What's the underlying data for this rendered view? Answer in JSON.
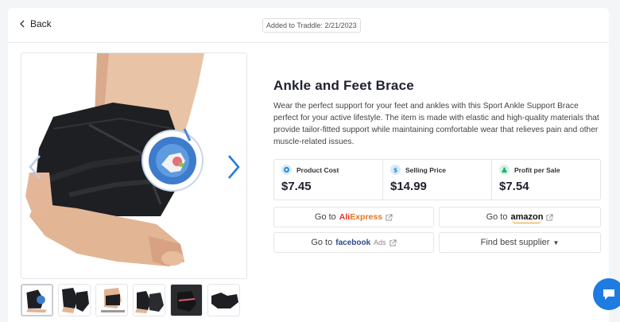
{
  "header": {
    "back_label": "Back",
    "added_label": "Added to Traddle: 2/21/2023"
  },
  "product": {
    "title": "Ankle and Feet Brace",
    "description": "Wear the perfect support for your feet and ankles with this Sport Ankle Support Brace perfect for your active lifestyle. The item is made with elastic and high-quality materials that provide tailor-fitted support while maintaining comfortable wear that relieves pain and other muscle-related issues."
  },
  "metrics": [
    {
      "label": "Product Cost",
      "value": "$7.45",
      "icon": "product-cost-icon",
      "color": "#2a8fe0"
    },
    {
      "label": "Selling Price",
      "value": "$14.99",
      "icon": "dollar-tag-icon",
      "color": "#2a8fe0"
    },
    {
      "label": "Profit per Sale",
      "value": "$7.54",
      "icon": "money-bag-icon",
      "color": "#22b573"
    }
  ],
  "actions": {
    "aliexpress_prefix": "Go to",
    "aliexpress_brand_first": "Ali",
    "aliexpress_brand_rest": "Express",
    "amazon_prefix": "Go to",
    "amazon_brand": "amazon",
    "facebook_prefix": "Go to",
    "facebook_brand": "facebook",
    "facebook_ads": "Ads",
    "supplier_label": "Find best supplier"
  },
  "gallery": {
    "thumbnail_count": 6,
    "active_index": 0
  },
  "colors": {
    "accent": "#1e7be1",
    "aliexpress": "#e8751a",
    "amazon_smile": "#f29b21",
    "facebook": "#2d4a8a"
  }
}
